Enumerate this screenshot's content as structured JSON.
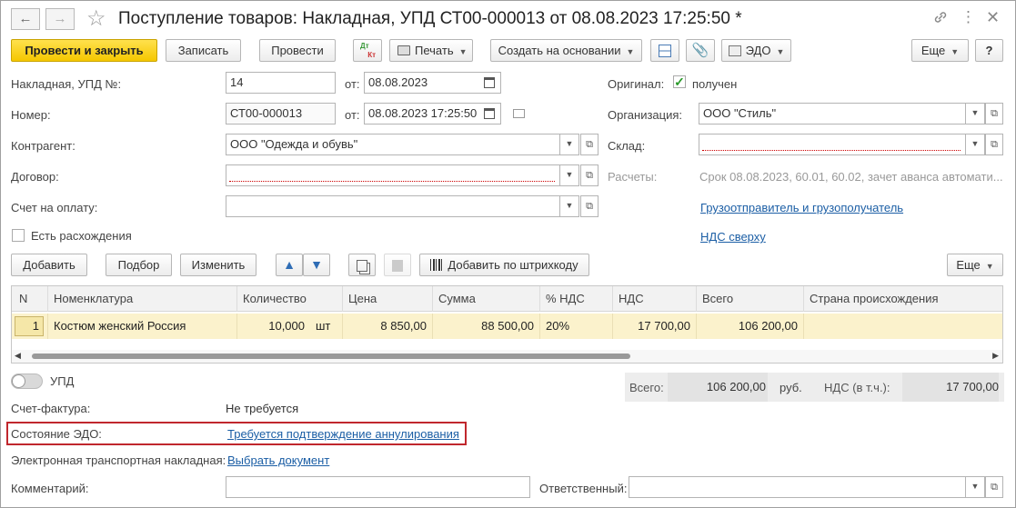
{
  "window": {
    "title": "Поступление товаров: Накладная, УПД СТ00-000013 от 08.08.2023 17:25:50 *"
  },
  "toolbar": {
    "post_close": "Провести и закрыть",
    "save": "Записать",
    "post": "Провести",
    "dtkt_top": "Дт",
    "dtkt_bottom": "Кт",
    "print": "Печать",
    "create_based": "Создать на основании",
    "edo": "ЭДО",
    "more": "Еще",
    "help": "?"
  },
  "form": {
    "invoice_label": "Накладная, УПД №:",
    "invoice_no": "14",
    "from_label": "от:",
    "invoice_date": "08.08.2023",
    "number_label": "Номер:",
    "number": "СТ00-000013",
    "number_date": "08.08.2023 17:25:50",
    "contractor_label": "Контрагент:",
    "contractor": "ООО \"Одежда и обувь\"",
    "contract_label": "Договор:",
    "contract": "",
    "pay_invoice_label": "Счет на оплату:",
    "pay_invoice": "",
    "discrepancy_label": "Есть расхождения",
    "original_label": "Оригинал:",
    "original_value": "получен",
    "org_label": "Организация:",
    "org": "ООО \"Стиль\"",
    "warehouse_label": "Склад:",
    "warehouse": "",
    "settlements_label": "Расчеты:",
    "settlements": "Срок 08.08.2023, 60.01, 60.02, зачет аванса автомати...",
    "shipper_link": "Грузоотправитель и грузополучатель",
    "vat_link": "НДС сверху"
  },
  "table_toolbar": {
    "add": "Добавить",
    "pick": "Подбор",
    "change": "Изменить",
    "barcode": "Добавить по штрихкоду",
    "more": "Еще"
  },
  "table": {
    "headers": [
      "N",
      "Номенклатура",
      "Количество",
      "Цена",
      "Сумма",
      "% НДС",
      "НДС",
      "Всего",
      "Страна происхождения"
    ],
    "rows": [
      {
        "n": "1",
        "item": "Костюм женский Россия",
        "qty": "10,000",
        "unit": "шт",
        "price": "8 850,00",
        "sum": "88 500,00",
        "vat_rate": "20%",
        "vat": "17 700,00",
        "total": "106 200,00",
        "country": ""
      }
    ]
  },
  "bottom": {
    "upd_label": "УПД",
    "invoice_label": "Счет-фактура:",
    "invoice_value": "Не требуется",
    "edo_state_label": "Состояние ЭДО:",
    "edo_state_link": "Требуется подтверждение аннулирования",
    "etn_label": "Электронная транспортная накладная:",
    "etn_link": "Выбрать документ",
    "comment_label": "Комментарий:",
    "comment": "",
    "responsible_label": "Ответственный:",
    "responsible": ""
  },
  "totals": {
    "total_label": "Всего:",
    "total": "106 200,00",
    "currency": "руб.",
    "vat_label": "НДС (в т.ч.):",
    "vat": "17 700,00"
  },
  "colors": {
    "primary_button": "#f5c700",
    "link": "#1b5ea5",
    "highlight_border": "#c0272d",
    "selected_row": "#fbf2cc"
  }
}
